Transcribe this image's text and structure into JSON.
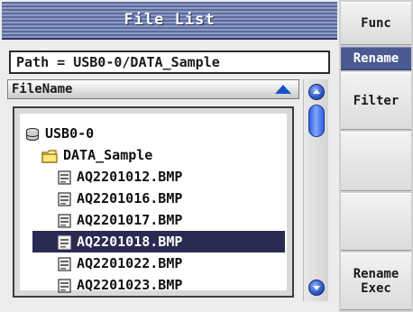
{
  "title": "File List",
  "path": "Path = USB0-0/DATA_Sample",
  "column_header": {
    "label": "FileName",
    "sort_icon": "sort-ascending-icon"
  },
  "tree": {
    "drive": {
      "label": "USB0-0",
      "icon": "drive-icon"
    },
    "folder": {
      "label": "DATA_Sample",
      "icon": "folder-icon"
    },
    "files": [
      {
        "label": "AQ2201012.BMP",
        "icon": "image-file-icon",
        "selected": false
      },
      {
        "label": "AQ2201016.BMP",
        "icon": "image-file-icon",
        "selected": false
      },
      {
        "label": "AQ2201017.BMP",
        "icon": "image-file-icon",
        "selected": false
      },
      {
        "label": "AQ2201018.BMP",
        "icon": "image-file-icon",
        "selected": true
      },
      {
        "label": "AQ2201022.BMP",
        "icon": "image-file-icon",
        "selected": false
      },
      {
        "label": "AQ2201023.BMP",
        "icon": "image-file-icon",
        "selected": false
      }
    ]
  },
  "softkeys": {
    "func": "Func",
    "rename": "Rename",
    "filter": "Filter",
    "rename_exec_line1": "Rename",
    "rename_exec_line2": "Exec"
  },
  "colors": {
    "title_bar": "#5a6a9c",
    "selection": "#2b2a52",
    "active_softkey": "#4a5a90",
    "scroll_accent": "#2b58c8"
  }
}
